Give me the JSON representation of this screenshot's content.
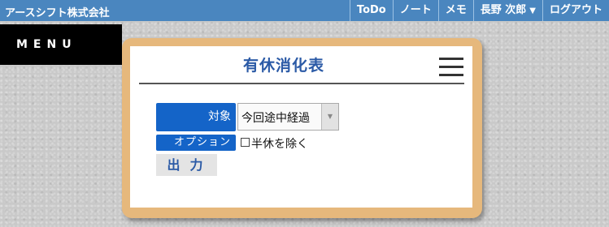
{
  "header": {
    "company": "アースシフト株式会社",
    "nav": [
      {
        "label": "ToDo"
      },
      {
        "label": "ノート"
      },
      {
        "label": "メモ"
      },
      {
        "label": "長野 次郎"
      },
      {
        "label": "ログアウト"
      }
    ]
  },
  "menu": {
    "label": "MENU"
  },
  "card": {
    "title": "有休消化表",
    "target_label": "対象",
    "target_value": "今回途中経過",
    "option_label": "オプション",
    "checkbox_label": "半休を除く",
    "checkbox_checked": false,
    "output_button": "出力"
  },
  "colors": {
    "header_bg": "#4a86bf",
    "label_bg": "#1464c8",
    "title_text": "#2b5aa6",
    "card_border": "#e6b87c"
  }
}
